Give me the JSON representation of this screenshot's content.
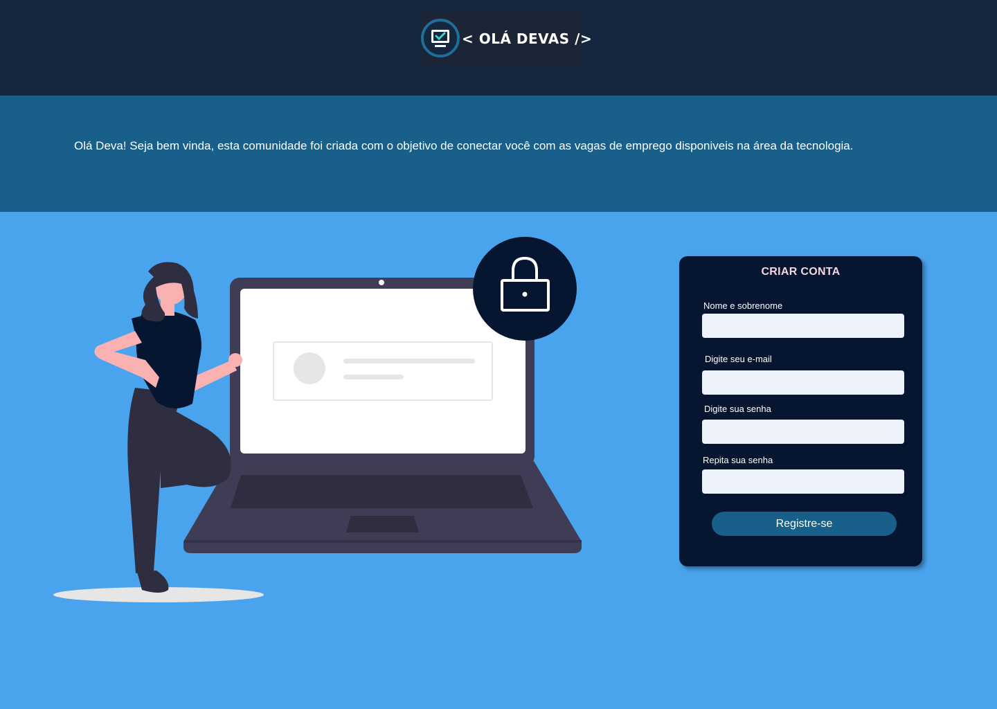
{
  "header": {
    "logo_text": "< OLÁ DEVAS />",
    "logo_icon": "monitor-check-icon"
  },
  "banner": {
    "text": "Olá Deva! Seja bem vinda, esta comunidade foi criada com o objetivo de conectar você com as vagas de emprego disponiveis na área da tecnologia."
  },
  "illustration": {
    "icons": [
      "woman-figure",
      "laptop-icon",
      "lock-icon",
      "avatar-placeholder-icon"
    ]
  },
  "signup": {
    "title": "CRIAR CONTA",
    "fields": [
      {
        "label": "Nome e sobrenome",
        "value": "",
        "placeholder": ""
      },
      {
        "label": "Digite seu e-mail",
        "value": "",
        "placeholder": ""
      },
      {
        "label": "Digite sua senha",
        "value": "",
        "placeholder": ""
      },
      {
        "label": "Repita sua senha",
        "value": "",
        "placeholder": ""
      }
    ],
    "submit_label": "Registre-se"
  },
  "colors": {
    "header_bg": "#14273f",
    "banner_bg": "#185f89",
    "main_bg": "#4aa3ed",
    "card_bg": "#061631",
    "input_bg": "#edf2fa",
    "button_bg": "#185f89",
    "title_color": "#f2d7e2",
    "skin": "#f9b2b1"
  }
}
